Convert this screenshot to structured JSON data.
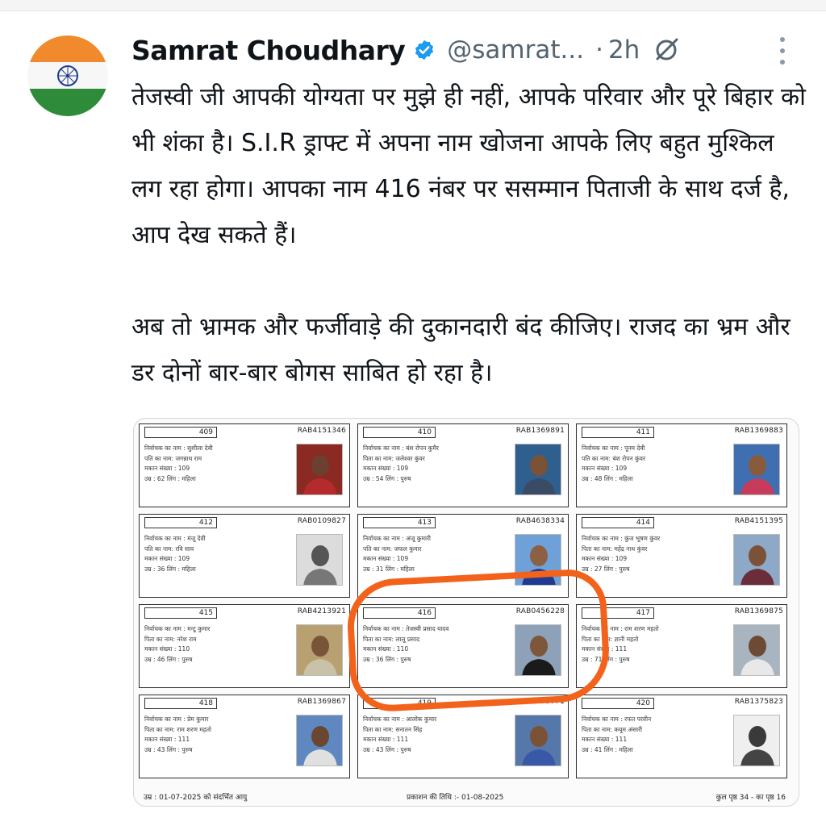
{
  "tweet": {
    "author_name": "Samrat Choudhary",
    "handle": "@samrat...",
    "separator": "·",
    "time": "2h",
    "icons": {
      "verified": "verified-badge-icon",
      "grok": "grok-icon",
      "more": "more-vertical-icon",
      "avatar": "india-flag-avatar"
    },
    "colors": {
      "accent": "#1d9bf0",
      "highlight": "#f2621b",
      "text": "#0f1419",
      "muted": "#536471"
    },
    "body": {
      "p1": "तेजस्वी जी आपकी योग्यता पर मुझे ही नहीं, आपके परिवार और पूरे बिहार को भी शंका है। S.I.R ड्राफ्ट में अपना नाम खोजना आपके लिए बहुत मुश्किल लग रहा होगा। आपका नाम 416 नंबर पर ससम्मान पिताजी के साथ दर्ज है, आप देख सकते हैं।",
      "p2": "अब तो भ्रामक और फर्जीवाड़े की दुकानदारी बंद कीजिए। राजद का भ्रम और डर दोनों बार-बार बोगस साबित हो रहा है।"
    }
  },
  "voter_list": {
    "cards": [
      {
        "serial": "409",
        "epic": "RAB4151346",
        "line1": "निर्वाचक का नाम : सुशीला देवी",
        "line2": "पति का नाम: जगन्नाथ राम",
        "line3": "मकान संख्या : 109",
        "line4": "उम्र : 62 लिंग : महिला"
      },
      {
        "serial": "410",
        "epic": "RAB1369891",
        "line1": "निर्वाचक का नाम : बंश रोपन कुमैर",
        "line2": "पिता का नाम: जलेश्वर कुंवर",
        "line3": "मकान संख्या : 109",
        "line4": "उम्र : 54 लिंग : पुरुष"
      },
      {
        "serial": "411",
        "epic": "RAB1369883",
        "line1": "निर्वाचक का नाम : पूनम देवी",
        "line2": "पति का नाम: बंश रोपन कुंवर",
        "line3": "मकान संख्या : 109",
        "line4": "उम्र : 48 लिंग : महिला"
      },
      {
        "serial": "412",
        "epic": "RAB0109827",
        "line1": "निर्वाचक का नाम : मंजू देवी",
        "line2": "पति का नाम: रवि साव",
        "line3": "मकान संख्या : 109",
        "line4": "उम्र : 36 लिंग : महिला"
      },
      {
        "serial": "413",
        "epic": "RAB4638334",
        "line1": "निर्वाचक का नाम : अंजू कुमारी",
        "line2": "पति का नाम: जफल कुमार",
        "line3": "मकान संख्या : 109",
        "line4": "उम्र : 31 लिंग : महिला"
      },
      {
        "serial": "414",
        "epic": "RAB4151395",
        "line1": "निर्वाचक का नाम : कुंज भूषण कुंवर",
        "line2": "पिता का नाम: महेंद्र नाथ कुंवर",
        "line3": "मकान संख्या : 109",
        "line4": "उम्र : 27 लिंग : पुरुष"
      },
      {
        "serial": "415",
        "epic": "RAB4213921",
        "line1": "निर्वाचक का नाम : मन्टू कुमार",
        "line2": "पिता का नाम: नरेश राम",
        "line3": "मकान संख्या : 110",
        "line4": "उम्र : 46 लिंग : पुरुष"
      },
      {
        "serial": "416",
        "epic": "RAB0456228",
        "line1": "निर्वाचक का नाम : तेजस्वी प्रसाद यादव",
        "line2": "पिता का नाम: लालू प्रसाद",
        "line3": "मकान संख्या : 110",
        "line4": "उम्र : 36 लिंग : पुरुष"
      },
      {
        "serial": "417",
        "epic": "RAB1369875",
        "line1": "निर्वाचक का नाम : राम शरण महतो",
        "line2": "पिता का नाम: ज्ञानी महतो",
        "line3": "मकान संख्या : 111",
        "line4": "उम्र : 71 लिंग : पुरुष"
      },
      {
        "serial": "418",
        "epic": "RAB1369867",
        "line1": "निर्वाचक का नाम : प्रेम कुमार",
        "line2": "पिता का नाम: राम शरण महतो",
        "line3": "मकान संख्या : 111",
        "line4": "उम्र : 43 लिंग : पुरुष"
      },
      {
        "serial": "419",
        "epic": "RAB4279771",
        "line1": "निर्वाचक का नाम : आलोक कुमार",
        "line2": "पिता का नाम: सनातन सिंह",
        "line3": "मकान संख्या : 111",
        "line4": "उम्र : 43 लिंग : पुरुष"
      },
      {
        "serial": "420",
        "epic": "RAB1375823",
        "line1": "निर्वाचक का नाम : रफत परवीन",
        "line2": "पिता का नाम: कयूम अंसारी",
        "line3": "मकान संख्या : 111",
        "line4": "उम्र : 41 लिंग : महिला"
      }
    ],
    "footer": {
      "left": "उम्र : 01-07-2025 को संदर्भित आयु",
      "center": "प्रकाशन की तिथि :- 01-08-2025",
      "right": "कुल पृष्ठ 34 - का पृष्ठ 16"
    }
  }
}
